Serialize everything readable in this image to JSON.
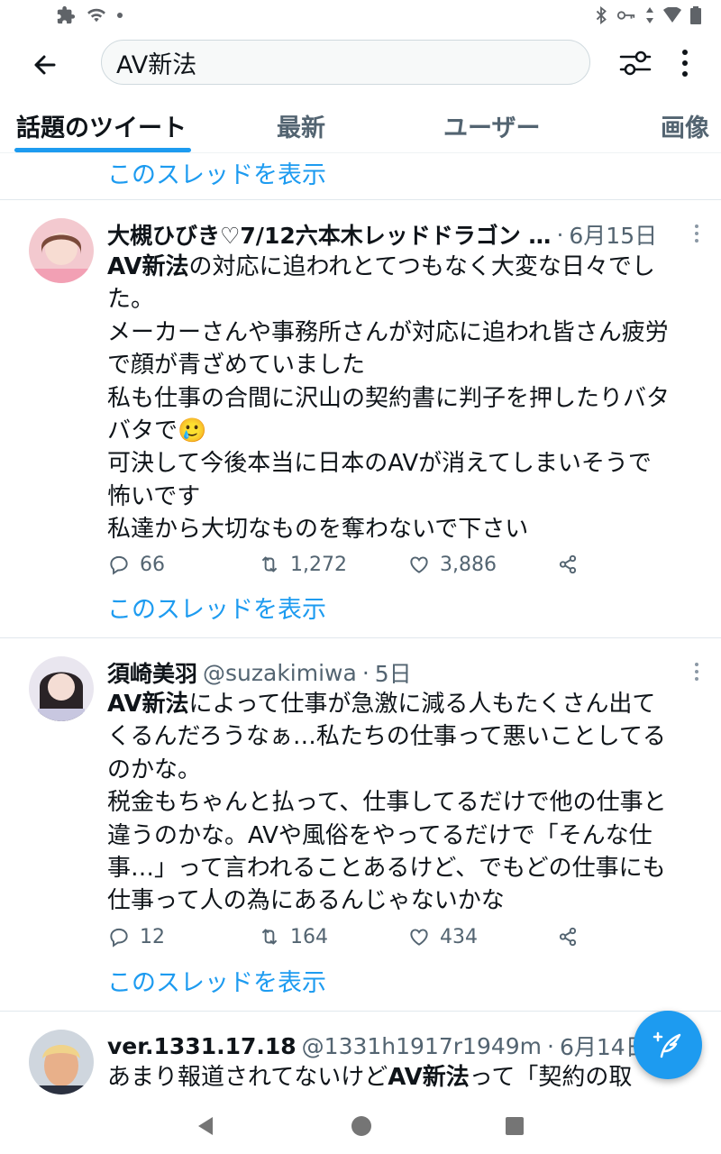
{
  "search": {
    "query": "AV新法"
  },
  "tabs": [
    {
      "label": "話題のツイート",
      "active": true
    },
    {
      "label": "最新"
    },
    {
      "label": "ユーザー"
    },
    {
      "label": "画像"
    }
  ],
  "thread_link_label": "このスレッドを表示",
  "tweets": [
    {
      "name": "大槻ひびき♡7/12六本木レッドドラゴン …",
      "handle": "",
      "date": "6月15日",
      "body_lines": [
        "の対応に追われとてつもなく大変な日々でし",
        "た。",
        "メーカーさんや事務所さんが対応に追われ皆さん疲労",
        "で顔が青ざめていました",
        "私も仕事の合間に沢山の契約書に判子を押したりバタ",
        "バタで",
        "可決して今後本当に日本のAVが消えてしまいそうで",
        "怖いです",
        "私達から大切なものを奪わないで下さい"
      ],
      "keyword": "AV新法",
      "emoji": "🥲",
      "replies": "66",
      "retweets": "1,272",
      "likes": "3,886"
    },
    {
      "name": "須崎美羽",
      "handle": "@suzakimiwa",
      "date": "5日",
      "body_lines": [
        "によって仕事が急激に減る人もたくさん出て",
        "くるんだろうなぁ…私たちの仕事って悪いことしてる",
        "のかな。",
        "税金もちゃんと払って、仕事してるだけで他の仕事と",
        "違うのかな。AVや風俗をやってるだけで「そんな仕",
        "事…」って言われることあるけど、でもどの仕事にも",
        "仕事って人の為にあるんじゃないかな"
      ],
      "keyword": "AV新法",
      "replies": "12",
      "retweets": "164",
      "likes": "434"
    },
    {
      "name": "ver.1331.17.18",
      "handle": "@1331h1917r1949m",
      "date": "6月14日",
      "body_prefix": "あまり報道されてないけど",
      "keyword": "AV新法",
      "body_suffix": "って「契約の取"
    }
  ],
  "colors": {
    "accent": "#1d9bf0",
    "text": "#0f1419",
    "muted": "#536471"
  },
  "icons": [
    "back-arrow-icon",
    "filter-icon",
    "more-vert-icon",
    "reply-icon",
    "retweet-icon",
    "like-icon",
    "share-icon",
    "compose-icon"
  ]
}
